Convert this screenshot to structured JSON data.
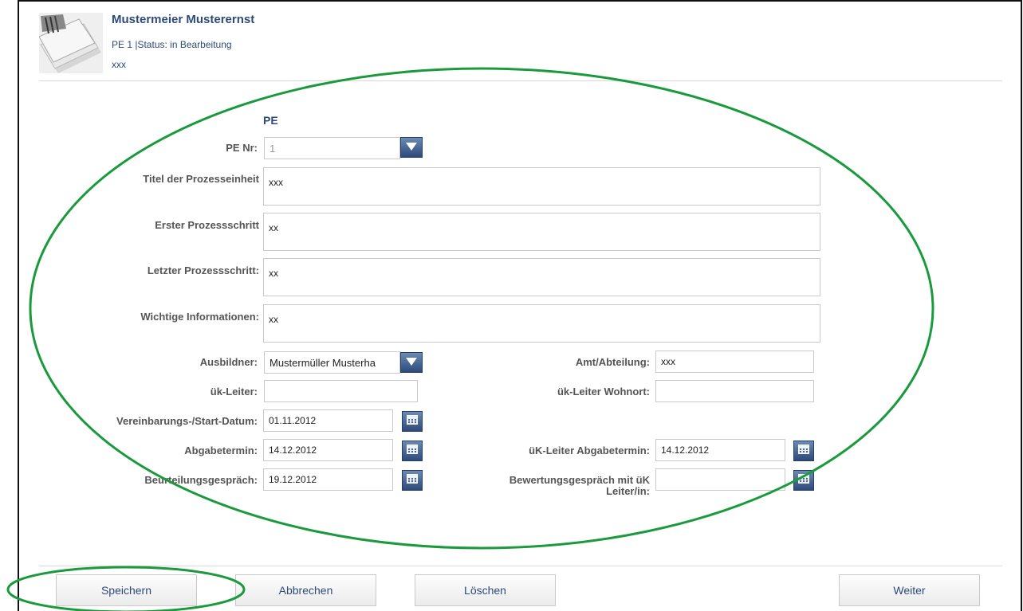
{
  "header": {
    "name": "Mustermeier Musterernst",
    "status": "PE 1 |Status: in Bearbeitung",
    "subtitle": "xxx"
  },
  "form": {
    "section_title": "PE",
    "pe_nr": {
      "label": "PE Nr:",
      "value": "1"
    },
    "titel": {
      "label": "Titel der Prozesseinheit",
      "value": "xxx"
    },
    "erster": {
      "label": "Erster Prozessschritt",
      "value": "xx"
    },
    "letzter": {
      "label": "Letzter Prozessschritt:",
      "value": "xx"
    },
    "wichtige": {
      "label": "Wichtige Informationen:",
      "value": "xx"
    },
    "ausbildner": {
      "label": "Ausbildner:",
      "value": "Mustermüller Musterha"
    },
    "amt": {
      "label": "Amt/Abteilung:",
      "value": "xxx"
    },
    "uk_leiter": {
      "label": "ük-Leiter:",
      "value": ""
    },
    "uk_leiter_wohnort": {
      "label": "ük-Leiter Wohnort:",
      "value": ""
    },
    "vereinbarung": {
      "label": "Vereinbarungs-/Start-Datum:",
      "value": "01.11.2012"
    },
    "abgabetermin": {
      "label": "Abgabetermin:",
      "value": "14.12.2012"
    },
    "uk_abgabetermin": {
      "label": "üK-Leiter Abgabetermin:",
      "value": "14.12.2012"
    },
    "beurteilung": {
      "label": "Beurteilungsgespräch:",
      "value": "19.12.2012"
    },
    "bewertung": {
      "label": "Bewertungsgespräch mit üK Leiter/in:",
      "value": ""
    }
  },
  "buttons": {
    "save": "Speichern",
    "cancel": "Abbrechen",
    "delete": "Löschen",
    "next": "Weiter"
  },
  "icons": {
    "dropdown": "chevron-down-icon",
    "calendar": "calendar-icon",
    "thumbnail": "document-stack-icon"
  },
  "colors": {
    "accent": "#2e4a7a",
    "annotation": "#1a9a3c"
  }
}
